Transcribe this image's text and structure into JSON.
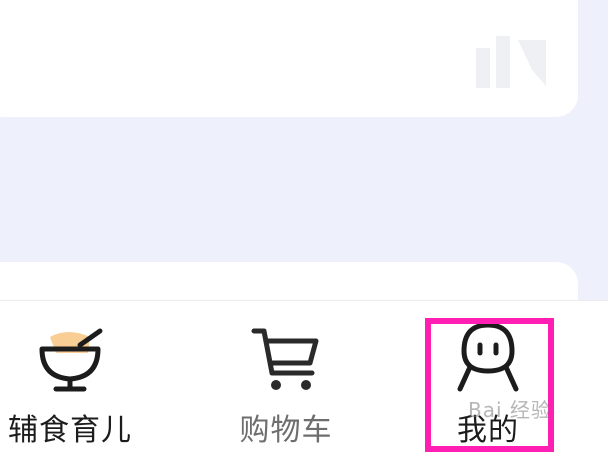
{
  "tabbar": {
    "tabs": [
      {
        "label": "辅食育儿",
        "icon": "bowl-icon"
      },
      {
        "label": "购物车",
        "icon": "shopping-cart-icon"
      },
      {
        "label": "我的",
        "icon": "user-face-icon"
      }
    ]
  },
  "watermark": {
    "text": "Bai 经验"
  },
  "colors": {
    "highlight": "#ff1fb3",
    "bowl_accent": "#f7c98a",
    "background": "#eef0fb"
  }
}
